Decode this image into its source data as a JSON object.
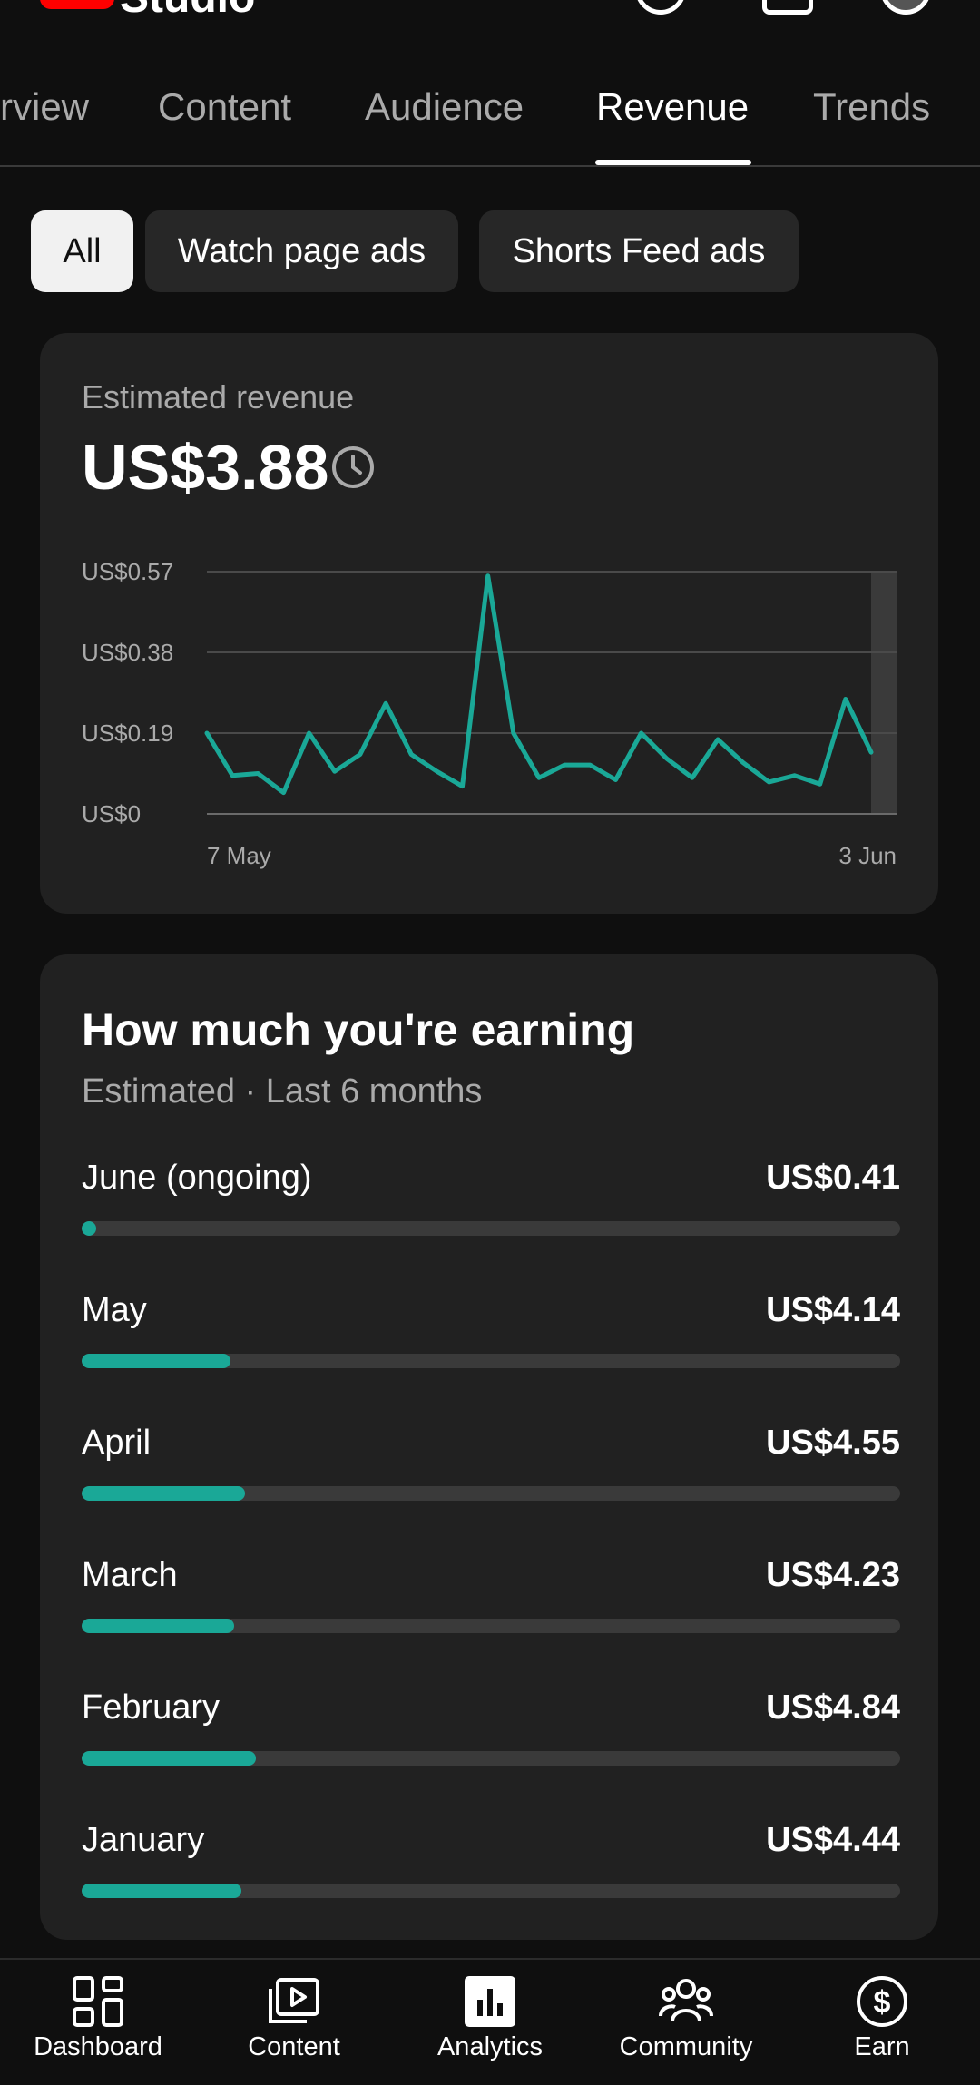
{
  "header": {
    "brand": "Studio"
  },
  "tabs": [
    {
      "label": "rview"
    },
    {
      "label": "Content"
    },
    {
      "label": "Audience"
    },
    {
      "label": "Revenue"
    },
    {
      "label": "Trends"
    }
  ],
  "filters": [
    {
      "label": "All",
      "selected": true
    },
    {
      "label": "Watch page ads",
      "selected": false
    },
    {
      "label": "Shorts Feed ads",
      "selected": false
    }
  ],
  "revenue_card": {
    "label": "Estimated revenue",
    "value": "US$3.88"
  },
  "chart_data": {
    "type": "line",
    "ytick_labels": [
      "US$0.57",
      "US$0.38",
      "US$0.19",
      "US$0"
    ],
    "yticks": [
      0.57,
      0.38,
      0.19,
      0
    ],
    "ylim": [
      0,
      0.57
    ],
    "x_start_label": "7 May",
    "x_end_label": "3 Jun",
    "values": [
      0.19,
      0.09,
      0.095,
      0.05,
      0.19,
      0.1,
      0.14,
      0.26,
      0.14,
      0.1,
      0.065,
      0.56,
      0.19,
      0.085,
      0.115,
      0.115,
      0.08,
      0.19,
      0.13,
      0.085,
      0.175,
      0.12,
      0.075,
      0.09,
      0.07,
      0.27,
      0.145
    ],
    "series_color": "#1aa897",
    "grid": true
  },
  "earnings": {
    "title": "How much you're earning",
    "subtitle": "Estimated · Last 6 months",
    "months": [
      {
        "name": "June (ongoing)",
        "value": "US$0.41",
        "fraction": 0.018
      },
      {
        "name": "May",
        "value": "US$4.14",
        "fraction": 0.182
      },
      {
        "name": "April",
        "value": "US$4.55",
        "fraction": 0.2
      },
      {
        "name": "March",
        "value": "US$4.23",
        "fraction": 0.186
      },
      {
        "name": "February",
        "value": "US$4.84",
        "fraction": 0.213
      },
      {
        "name": "January",
        "value": "US$4.44",
        "fraction": 0.195
      }
    ],
    "bar_color": "#1aa897"
  },
  "bottom_nav": [
    {
      "label": "Dashboard",
      "icon": "dashboard-icon"
    },
    {
      "label": "Content",
      "icon": "content-icon"
    },
    {
      "label": "Analytics",
      "icon": "analytics-icon"
    },
    {
      "label": "Community",
      "icon": "community-icon"
    },
    {
      "label": "Earn",
      "icon": "earn-icon"
    }
  ]
}
